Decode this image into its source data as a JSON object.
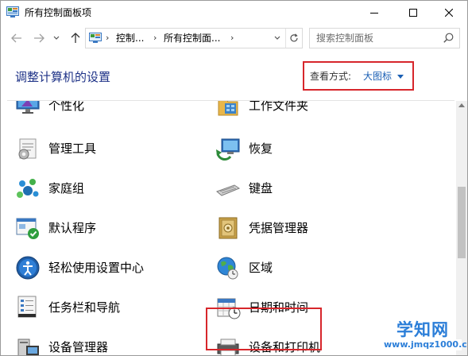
{
  "window": {
    "title": "所有控制面板项",
    "controls": {
      "minimize": "minimize-icon",
      "maximize": "maximize-icon",
      "close": "close-icon"
    }
  },
  "navigation": {
    "breadcrumbs": [
      "控制...",
      "所有控制面...",
      ""
    ],
    "search": {
      "placeholder": "搜索控制面板"
    }
  },
  "header": {
    "title": "调整计算机的设置",
    "view_by_label": "查看方式:",
    "view_by_value": "大图标"
  },
  "items": [
    {
      "label": "个性化",
      "icon": "personalization-icon"
    },
    {
      "label": "工作文件夹",
      "icon": "work-folders-icon"
    },
    {
      "label": "管理工具",
      "icon": "administrative-tools-icon"
    },
    {
      "label": "恢复",
      "icon": "recovery-icon"
    },
    {
      "label": "家庭组",
      "icon": "homegroup-icon"
    },
    {
      "label": "键盘",
      "icon": "keyboard-icon"
    },
    {
      "label": "默认程序",
      "icon": "default-programs-icon"
    },
    {
      "label": "凭据管理器",
      "icon": "credential-manager-icon"
    },
    {
      "label": "轻松使用设置中心",
      "icon": "ease-of-access-icon"
    },
    {
      "label": "区域",
      "icon": "region-icon"
    },
    {
      "label": "任务栏和导航",
      "icon": "taskbar-navigation-icon"
    },
    {
      "label": "日期和时间",
      "icon": "date-time-icon"
    },
    {
      "label": "设备管理器",
      "icon": "device-manager-icon"
    },
    {
      "label": "设备和打印机",
      "icon": "devices-printers-icon"
    }
  ],
  "highlight_color": "#d7262b",
  "watermark": {
    "title": "学知网",
    "url": "www.jmqz1000.com"
  }
}
